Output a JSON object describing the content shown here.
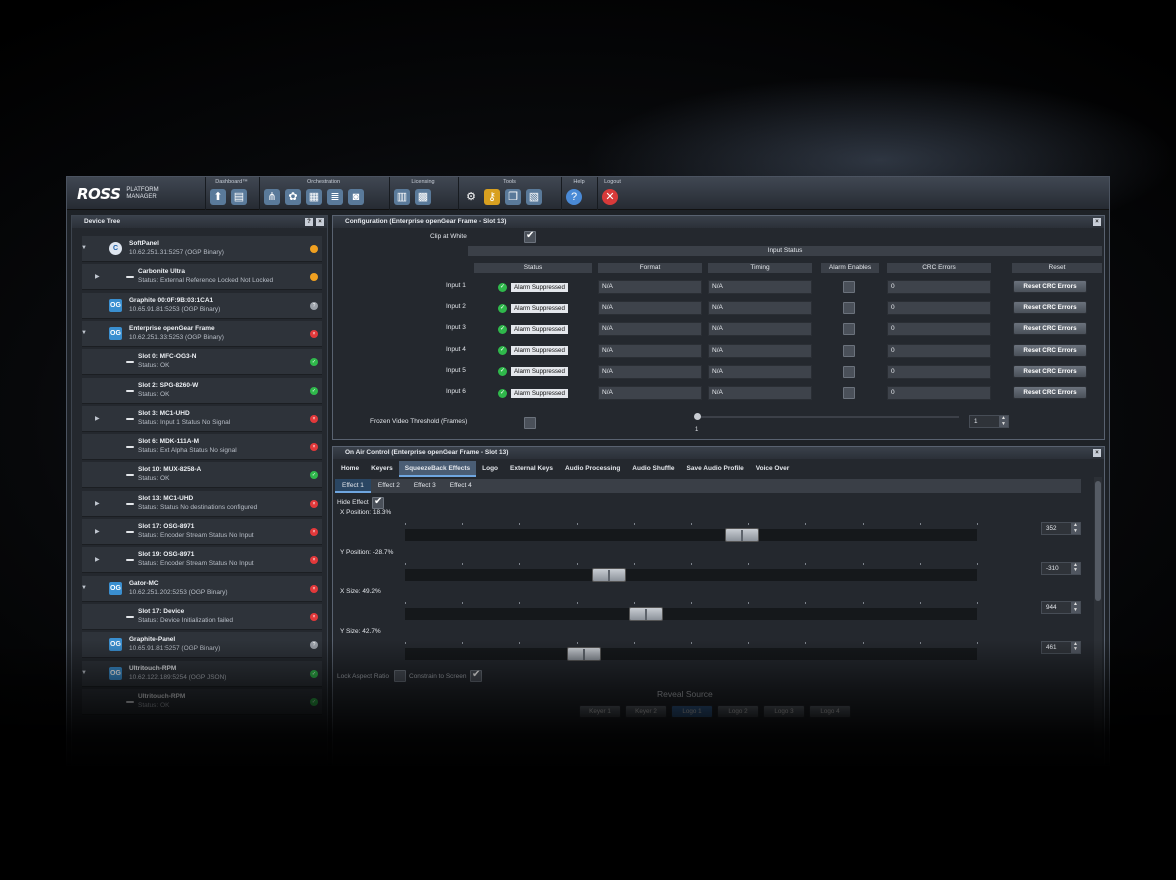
{
  "colors": {
    "ok": "#2fb84b",
    "warning": "#f0a020",
    "error": "#e2383a",
    "unknown": "#9aa0a8",
    "accent": "#6fa6e0"
  },
  "toolbar": {
    "logo": "ROSS",
    "product": "PLATFORM MANAGER",
    "groups": [
      {
        "label": "Dashboard™",
        "icons": [
          "dashboard-icon",
          "tree-layout-icon"
        ]
      },
      {
        "label": "Orchestration",
        "icons": [
          "flow-icon",
          "devices-icon",
          "folder-icon",
          "database-icon",
          "camera-icon"
        ]
      },
      {
        "label": "Licensing",
        "icons": [
          "license-icon",
          "chart-icon"
        ]
      },
      {
        "label": "Tools",
        "icons": [
          "gear-icon",
          "key-icon",
          "windows-icon",
          "document-icon"
        ]
      },
      {
        "label": "Help",
        "icons": [
          "help-icon"
        ]
      },
      {
        "label": "Logout",
        "icons": [
          "logout-icon"
        ]
      }
    ]
  },
  "tree": {
    "title": "Device Tree",
    "items": [
      {
        "name": "SoftPanel",
        "sub": "10.62.251.31:5257 (OGP Binary)",
        "icon": "C",
        "status": "warning"
      },
      {
        "name": "Carbonite Ultra",
        "sub": "Status: External Reference Locked Not Locked",
        "icon": "-",
        "status": "warning"
      },
      {
        "name": "Graphite 00:0F:9B:03:1CA1",
        "sub": "10.65.91.81:5253 (OGP Binary)",
        "icon": "OG",
        "status": "unknown"
      },
      {
        "name": "Enterprise openGear Frame",
        "sub": "10.62.251.33:5253 (OGP Binary)",
        "icon": "OG",
        "status": "error"
      },
      {
        "name": "Slot 0: MFC-OG3-N",
        "sub": "Status: OK",
        "icon": "-",
        "status": "ok"
      },
      {
        "name": "Slot 2: SPG-8260-W",
        "sub": "Status: OK",
        "icon": "-",
        "status": "ok"
      },
      {
        "name": "Slot 3: MC1-UHD",
        "sub": "Status: Input 1 Status No Signal",
        "icon": "-",
        "status": "error"
      },
      {
        "name": "Slot 6: MDK-111A-M",
        "sub": "Status: Ext Alpha Status No signal",
        "icon": "-",
        "status": "error"
      },
      {
        "name": "Slot 10: MUX-8258-A",
        "sub": "Status: OK",
        "icon": "-",
        "status": "ok"
      },
      {
        "name": "Slot 13: MC1-UHD",
        "sub": "Status: Status No destinations configured",
        "icon": "-",
        "status": "error"
      },
      {
        "name": "Slot 17: OSG-8971",
        "sub": "Status: Encoder Stream Status No Input",
        "icon": "-",
        "status": "error"
      },
      {
        "name": "Slot 19: OSG-8971",
        "sub": "Status: Encoder Stream Status No Input",
        "icon": "-",
        "status": "error"
      },
      {
        "name": "Gator-MC",
        "sub": "10.62.251.202:5253 (OGP Binary)",
        "icon": "OG",
        "status": "error"
      },
      {
        "name": "Slot 17: Device",
        "sub": "Status: Device Initialization failed",
        "icon": "-",
        "status": "error"
      },
      {
        "name": "Graphite-Panel",
        "sub": "10.65.91.81:5257 (OGP Binary)",
        "icon": "OG",
        "status": "unknown"
      },
      {
        "name": "Ultritouch-RPM",
        "sub": "10.62.122.189:5254 (OGP JSON)",
        "icon": "OG",
        "status": "ok"
      },
      {
        "name": "Ultritouch-RPM",
        "sub": "Status: OK",
        "icon": "-",
        "status": "ok"
      }
    ]
  },
  "config": {
    "title": "Configuration (Enterprise openGear Frame - Slot 13)",
    "clip_label": "Clip at White",
    "input_status_header": "Input Status",
    "columns": [
      "Status",
      "Format",
      "Timing",
      "Alarm Enables",
      "CRC Errors",
      "Reset"
    ],
    "rows": [
      {
        "label": "Input 1",
        "status": "Alarm Suppressed",
        "format": "N/A",
        "timing": "N/A",
        "crc": "0",
        "reset": "Reset CRC Errors"
      },
      {
        "label": "Input 2",
        "status": "Alarm Suppressed",
        "format": "N/A",
        "timing": "N/A",
        "crc": "0",
        "reset": "Reset CRC Errors"
      },
      {
        "label": "Input 3",
        "status": "Alarm Suppressed",
        "format": "N/A",
        "timing": "N/A",
        "crc": "0",
        "reset": "Reset CRC Errors"
      },
      {
        "label": "Input 4",
        "status": "Alarm Suppressed",
        "format": "N/A",
        "timing": "N/A",
        "crc": "0",
        "reset": "Reset CRC Errors"
      },
      {
        "label": "Input 5",
        "status": "Alarm Suppressed",
        "format": "N/A",
        "timing": "N/A",
        "crc": "0",
        "reset": "Reset CRC Errors"
      },
      {
        "label": "Input 6",
        "status": "Alarm Suppressed",
        "format": "N/A",
        "timing": "N/A",
        "crc": "0",
        "reset": "Reset CRC Errors"
      }
    ],
    "frozen_label": "Frozen Video Threshold (Frames)",
    "frozen_min": "1",
    "frozen_value": "1"
  },
  "onair": {
    "title": "On Air Control (Enterprise openGear Frame - Slot 13)",
    "tabs": [
      "Home",
      "Keyers",
      "SqueezeBack Effects",
      "Logo",
      "External Keys",
      "Audio Processing",
      "Audio Shuffle",
      "Save Audio Profile",
      "Voice Over"
    ],
    "active_tab": "SqueezeBack Effects",
    "subtabs": [
      "Effect 1",
      "Effect 2",
      "Effect 3",
      "Effect 4"
    ],
    "hide_effect": "Hide Effect",
    "sliders": [
      {
        "label": "X Position: 18.3%",
        "value": "352",
        "fraction": 0.59
      },
      {
        "label": "Y Position: -28.7%",
        "value": "-310",
        "fraction": 0.357
      },
      {
        "label": "X Size: 49.2%",
        "value": "944",
        "fraction": 0.422
      },
      {
        "label": "Y Size: 42.7%",
        "value": "461",
        "fraction": 0.313
      }
    ],
    "lock_aspect": "Lock Aspect Ratio",
    "constrain": "Constrain to Screen",
    "reveal_source": "Reveal Source",
    "reveal_buttons": [
      "Keyer 1",
      "Keyer 2",
      "Logo 1",
      "Logo 2",
      "Logo 3",
      "Logo 4"
    ]
  }
}
